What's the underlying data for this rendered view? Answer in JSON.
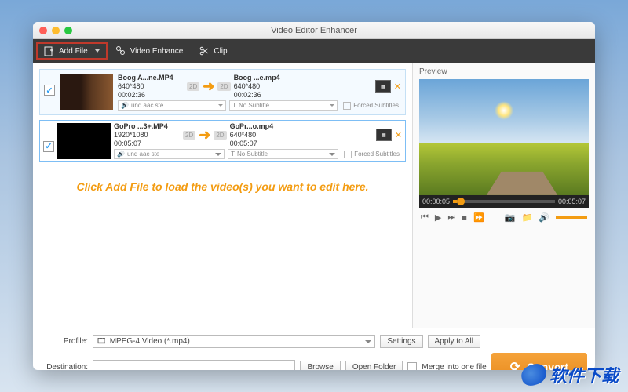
{
  "window": {
    "title": "Video Editor Enhancer"
  },
  "toolbar": {
    "add_file": "Add File",
    "video_enhance": "Video Enhance",
    "clip": "Clip"
  },
  "files": [
    {
      "checked": true,
      "src_name": "Boog A...ne.MP4",
      "src_res": "640*480",
      "src_dur": "00:02:36",
      "dst_name": "Boog ...e.mp4",
      "dst_res": "640*480",
      "dst_dur": "00:02:36",
      "audio": "und aac ste",
      "subtitle": "No Subtitle",
      "forced": "Forced Subtitles"
    },
    {
      "checked": true,
      "src_name": "GoPro ...3+.MP4",
      "src_res": "1920*1080",
      "src_dur": "00:05:07",
      "dst_name": "GoPr...o.mp4",
      "dst_res": "640*480",
      "dst_dur": "00:05:07",
      "audio": "und aac ste",
      "subtitle": "No Subtitle",
      "forced": "Forced Subtitles"
    }
  ],
  "hint": "Click Add File to load the video(s) you want to edit here.",
  "preview": {
    "label": "Preview",
    "time_cur": "00:00:05",
    "time_tot": "00:05:07"
  },
  "bottom": {
    "profile_label": "Profile:",
    "profile_value": "MPEG-4 Video (*.mp4)",
    "settings": "Settings",
    "apply_all": "Apply to All",
    "dest_label": "Destination:",
    "dest_value": "",
    "browse": "Browse",
    "open_folder": "Open Folder",
    "merge": "Merge into one file",
    "convert": "Convert"
  },
  "watermark": "软件下载"
}
